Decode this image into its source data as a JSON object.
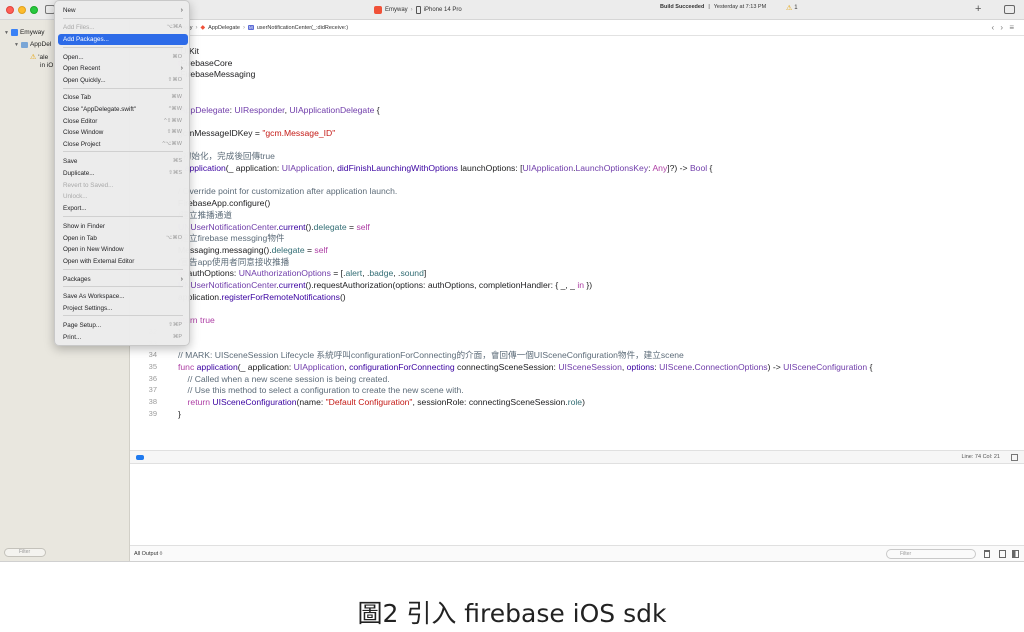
{
  "titlebar": {
    "scheme": "Emyway",
    "device": "iPhone 14 Pro",
    "status_bold": "Build Succeeded",
    "status_time": "Yesterday at 7:13 PM",
    "warning_count": "1",
    "add_label": "+"
  },
  "navigator": {
    "project": "Emyway",
    "target": "AppDel",
    "warning_line1": "'ale",
    "warning_line2": "in iO",
    "filter_placeholder": "Filter"
  },
  "breadcrumb": {
    "item1": "yway",
    "item2": "AppDelegate",
    "item3": "userNotificationCenter(_:didReceive:)",
    "method_badge": "M"
  },
  "file_menu": {
    "items": [
      {
        "label": "New",
        "shortcut": "",
        "submenu": true,
        "disabled": false,
        "highlighted": false
      },
      {
        "label": "Add Files...",
        "shortcut": "⌥⌘A",
        "submenu": false,
        "disabled": true,
        "highlighted": false
      },
      {
        "label": "Add Packages...",
        "shortcut": "",
        "submenu": false,
        "disabled": false,
        "highlighted": true
      },
      {
        "label": "Open...",
        "shortcut": "⌘O",
        "submenu": false,
        "disabled": false,
        "highlighted": false
      },
      {
        "label": "Open Recent",
        "shortcut": "",
        "submenu": true,
        "disabled": false,
        "highlighted": false
      },
      {
        "label": "Open Quickly...",
        "shortcut": "⇧⌘O",
        "submenu": false,
        "disabled": false,
        "highlighted": false
      },
      {
        "label": "Close Tab",
        "shortcut": "⌘W",
        "submenu": false,
        "disabled": false,
        "highlighted": false
      },
      {
        "label": "Close \"AppDelegate.swift\"",
        "shortcut": "^⌘W",
        "submenu": false,
        "disabled": false,
        "highlighted": false
      },
      {
        "label": "Close Editor",
        "shortcut": "^⇧⌘W",
        "submenu": false,
        "disabled": false,
        "highlighted": false
      },
      {
        "label": "Close Window",
        "shortcut": "⇧⌘W",
        "submenu": false,
        "disabled": false,
        "highlighted": false
      },
      {
        "label": "Close Project",
        "shortcut": "^⌥⌘W",
        "submenu": false,
        "disabled": false,
        "highlighted": false
      },
      {
        "label": "Save",
        "shortcut": "⌘S",
        "submenu": false,
        "disabled": false,
        "highlighted": false
      },
      {
        "label": "Duplicate...",
        "shortcut": "⇧⌘S",
        "submenu": false,
        "disabled": false,
        "highlighted": false
      },
      {
        "label": "Revert to Saved...",
        "shortcut": "",
        "submenu": false,
        "disabled": true,
        "highlighted": false
      },
      {
        "label": "Unlock...",
        "shortcut": "",
        "submenu": false,
        "disabled": true,
        "highlighted": false
      },
      {
        "label": "Export...",
        "shortcut": "",
        "submenu": false,
        "disabled": false,
        "highlighted": false
      },
      {
        "label": "Show in Finder",
        "shortcut": "",
        "submenu": false,
        "disabled": false,
        "highlighted": false
      },
      {
        "label": "Open in Tab",
        "shortcut": "⌥⌘O",
        "submenu": false,
        "disabled": false,
        "highlighted": false
      },
      {
        "label": "Open in New Window",
        "shortcut": "",
        "submenu": false,
        "disabled": false,
        "highlighted": false
      },
      {
        "label": "Open with External Editor",
        "shortcut": "",
        "submenu": false,
        "disabled": false,
        "highlighted": false
      },
      {
        "label": "Packages",
        "shortcut": "",
        "submenu": true,
        "disabled": false,
        "highlighted": false
      },
      {
        "label": "Save As Workspace...",
        "shortcut": "",
        "submenu": false,
        "disabled": false,
        "highlighted": false
      },
      {
        "label": "Project Settings...",
        "shortcut": "",
        "submenu": false,
        "disabled": false,
        "highlighted": false
      },
      {
        "label": "Page Setup...",
        "shortcut": "⇧⌘P",
        "submenu": false,
        "disabled": false,
        "highlighted": false
      },
      {
        "label": "Print...",
        "shortcut": "⌘P",
        "submenu": false,
        "disabled": false,
        "highlighted": false
      }
    ]
  },
  "code_lines": [
    {
      "ln": "",
      "segs": [
        [
          "kw",
          "t"
        ],
        [
          "",
          "UIKit"
        ]
      ]
    },
    {
      "ln": "",
      "segs": [
        [
          "kw",
          "t"
        ],
        [
          "",
          "FirebaseCore"
        ]
      ]
    },
    {
      "ln": "",
      "segs": [
        [
          "kw",
          "t"
        ],
        [
          "",
          "FirebaseMessaging"
        ]
      ]
    },
    {
      "ln": "",
      "segs": []
    },
    {
      "ln": "",
      "segs": [
        [
          "kw",
          "in"
        ]
      ]
    },
    {
      "ln": "",
      "segs": [
        [
          "ty",
          " AppDelegate"
        ],
        [
          "",
          ": "
        ],
        [
          "ty",
          "UIResponder"
        ],
        [
          "",
          ", "
        ],
        [
          "ty",
          "UIApplicationDelegate"
        ],
        [
          "",
          " {"
        ]
      ]
    },
    {
      "ln": "",
      "segs": []
    },
    {
      "ln": "",
      "segs": [
        [
          "",
          "gcmMessageIDKey = "
        ],
        [
          "st",
          "\"gcm.Message_ID\""
        ]
      ]
    },
    {
      "ln": "",
      "segs": []
    },
    {
      "ln": "",
      "segs": [
        [
          "cm",
          "p初始化，完成後回傳true"
        ]
      ]
    },
    {
      "ln": "",
      "segs": [
        [
          "kw",
          "c "
        ],
        [
          "fn",
          "application"
        ],
        [
          "",
          "(_ application: "
        ],
        [
          "ty",
          "UIApplication"
        ],
        [
          "",
          ", "
        ],
        [
          "fn",
          "didFinishLaunchingWithOptions"
        ],
        [
          "",
          " launchOptions: ["
        ],
        [
          "ty",
          "UIApplication"
        ],
        [
          "",
          "."
        ],
        [
          "ty",
          "LaunchOptionsKey"
        ],
        [
          "",
          ": "
        ],
        [
          "kw",
          "Any"
        ],
        [
          "",
          "]?) -> "
        ],
        [
          "ty",
          "Bool"
        ],
        [
          "",
          " {"
        ]
      ]
    },
    {
      "ln": "",
      "segs": []
    },
    {
      "ln": "",
      "segs": [
        [
          "cm",
          "/ Override point for customization after application launch."
        ]
      ]
    },
    {
      "ln": "",
      "segs": [
        [
          "",
          "FirebaseApp.configure()"
        ]
      ]
    },
    {
      "ln": "",
      "segs": [
        [
          "cm",
          "/建立推播通道"
        ]
      ]
    },
    {
      "ln": "",
      "segs": [
        [
          "ty",
          "UNUserNotificationCenter"
        ],
        [
          "",
          "."
        ],
        [
          "fn",
          "current"
        ],
        [
          "",
          "()."
        ],
        [
          "pr",
          "delegate"
        ],
        [
          "",
          " = "
        ],
        [
          "kw",
          "self"
        ]
      ]
    },
    {
      "ln": "",
      "segs": [
        [
          "cm",
          "/建立firebase messging物件"
        ]
      ]
    },
    {
      "ln": "",
      "segs": [
        [
          "",
          "Messaging.messaging()."
        ],
        [
          "pr",
          "delegate"
        ],
        [
          "",
          " = "
        ],
        [
          "kw",
          "self"
        ]
      ]
    },
    {
      "ln": "",
      "segs": [
        [
          "cm",
          "/宣告app使用者同意接收推播"
        ]
      ]
    },
    {
      "ln": "",
      "segs": [
        [
          "kw",
          "et"
        ],
        [
          "",
          " authOptions: "
        ],
        [
          "ty",
          "UNAuthorizationOptions"
        ],
        [
          "",
          " = [."
        ],
        [
          "pr",
          "alert"
        ],
        [
          "",
          ", ."
        ],
        [
          "pr",
          "badge"
        ],
        [
          "",
          ", ."
        ],
        [
          "pr",
          "sound"
        ],
        [
          "",
          "]"
        ]
      ]
    },
    {
      "ln": "",
      "segs": [
        [
          "ty",
          "UNUserNotificationCenter"
        ],
        [
          "",
          "."
        ],
        [
          "fn",
          "current"
        ],
        [
          "",
          "().requestAuthorization(options: authOptions, completionHandler: { _, _ "
        ],
        [
          "kw",
          "in"
        ],
        [
          "",
          " })"
        ]
      ]
    },
    {
      "ln": "",
      "segs": [
        [
          "",
          "application."
        ],
        [
          "fn",
          "registerForRemoteNotifications"
        ],
        [
          "",
          "()"
        ]
      ]
    },
    {
      "ln": "",
      "segs": []
    },
    {
      "ln": "",
      "segs": [
        [
          "kw",
          "eturn true"
        ]
      ]
    },
    {
      "ln": "32",
      "segs": [
        [
          "",
          "}"
        ]
      ]
    },
    {
      "ln": "33",
      "segs": []
    },
    {
      "ln": "34",
      "segs": [
        [
          "cm",
          "// MARK: UISceneSession Lifecycle 系統呼叫configurationForConnecting的介面，會回傳一個UISceneConfiguration物件，建立scene"
        ]
      ]
    },
    {
      "ln": "35",
      "segs": [
        [
          "kw",
          "func "
        ],
        [
          "fn",
          "application"
        ],
        [
          "",
          "(_ application: "
        ],
        [
          "ty",
          "UIApplication"
        ],
        [
          "",
          ", "
        ],
        [
          "fn",
          "configurationForConnecting"
        ],
        [
          "",
          " connectingSceneSession: "
        ],
        [
          "ty",
          "UISceneSession"
        ],
        [
          "",
          ", "
        ],
        [
          "fn",
          "options"
        ],
        [
          "",
          ": "
        ],
        [
          "ty",
          "UIScene"
        ],
        [
          "",
          "."
        ],
        [
          "ty",
          "ConnectionOptions"
        ],
        [
          "",
          ") -> "
        ],
        [
          "ty",
          "UISceneConfiguration"
        ],
        [
          "",
          " {"
        ]
      ]
    },
    {
      "ln": "36",
      "segs": [
        [
          "cm",
          "    // Called when a new scene session is being created."
        ]
      ]
    },
    {
      "ln": "37",
      "segs": [
        [
          "cm",
          "    // Use this method to select a configuration to create the new scene with."
        ]
      ]
    },
    {
      "ln": "38",
      "segs": [
        [
          "kw",
          "    return "
        ],
        [
          "fn",
          "UISceneConfiguration"
        ],
        [
          "",
          "(name: "
        ],
        [
          "st",
          "\"Default Configuration\""
        ],
        [
          "",
          ", sessionRole: connectingSceneSession."
        ],
        [
          "pr",
          "role"
        ],
        [
          "",
          ")"
        ]
      ]
    },
    {
      "ln": "39",
      "segs": [
        [
          "",
          "}"
        ]
      ]
    }
  ],
  "debug": {
    "line_col": "Line: 74  Col: 21",
    "all_output": "All Output ◊",
    "console_filter": "Filter"
  },
  "caption": "圖2 引入 firebase iOS sdk",
  "colors": {
    "highlight": "#2d6be8",
    "keyword": "#ad3da4",
    "type": "#703daa",
    "string": "#c41a16"
  }
}
